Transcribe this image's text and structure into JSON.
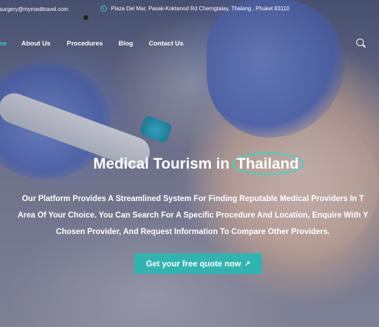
{
  "topbar": {
    "email": "tsurgery@mymeditravel.com",
    "address": "Plaza Del Mar, Pasak-Koktanod Rd Cherngtalay, Thalang , Phuket 83110"
  },
  "nav": {
    "items": [
      {
        "label": "me",
        "active": true
      },
      {
        "label": "About Us"
      },
      {
        "label": "Procedures"
      },
      {
        "label": "Blog"
      },
      {
        "label": "Contact Us"
      }
    ],
    "search_icon": "search-icon"
  },
  "hero": {
    "title_prefix": "Medical Tourism in",
    "title_highlight": "Thailand",
    "description_lines": [
      "Our Platform Provides A Streamlined System For Finding Reputable Medical Providers In T",
      "Area Of Your Choice. You Can Search For A Specific Procedure And Location, Enquire With Y",
      "Chosen Provider, And Request Information To Compare Other Providers."
    ],
    "cta_label": "Get your free quote now",
    "cta_icon": "↗"
  },
  "colors": {
    "accent": "#36d3c0",
    "cta_background": "#33b3b0",
    "text": "#ffffff"
  }
}
